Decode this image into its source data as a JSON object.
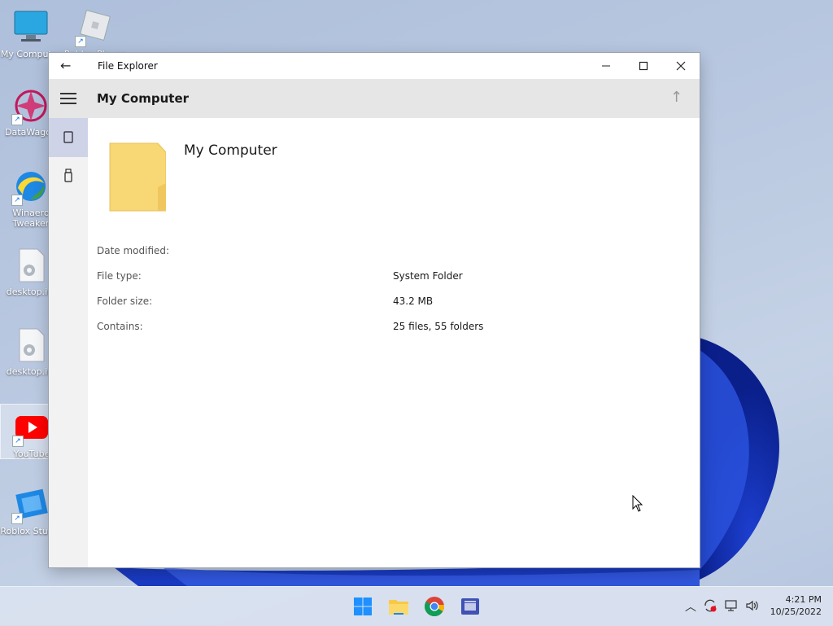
{
  "desktop": {
    "icons": [
      {
        "label": "My Computer"
      },
      {
        "label": "Roblox Player"
      },
      {
        "label": "DataWagon"
      },
      {
        "label": "Winaero Tweaker"
      },
      {
        "label": "desktop.ini"
      },
      {
        "label": "desktop.ini"
      },
      {
        "label": "YouTube"
      },
      {
        "label": "Roblox Studio"
      }
    ]
  },
  "window": {
    "app_title": "File Explorer",
    "breadcrumb": "My Computer",
    "item": {
      "name": "My Computer",
      "properties": [
        {
          "label": "Date modified:",
          "value": ""
        },
        {
          "label": "File type:",
          "value": "System Folder"
        },
        {
          "label": "Folder size:",
          "value": "43.2 MB"
        },
        {
          "label": "Contains:",
          "value": "25 files, 55 folders"
        }
      ]
    }
  },
  "taskbar": {
    "time": "4:21 PM",
    "date": "10/25/2022"
  },
  "colors": {
    "accent_nav": "#cfd3e8",
    "folder": "#f8d775",
    "windows_blue": "#1f3fbf"
  }
}
